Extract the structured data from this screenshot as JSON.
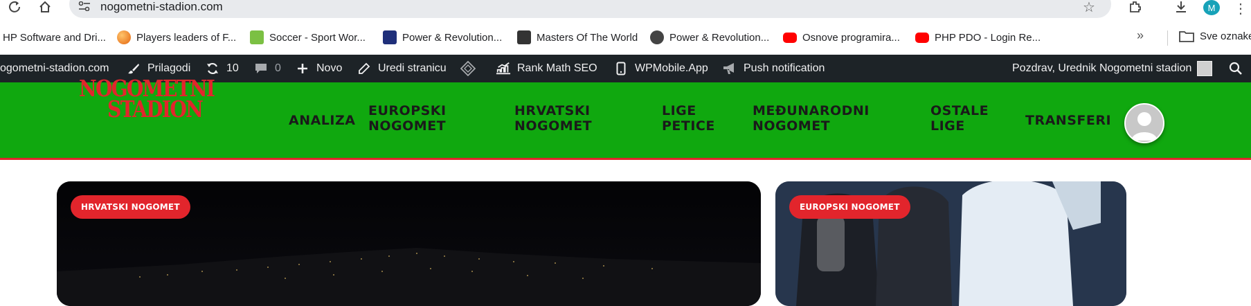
{
  "browser": {
    "url": "nogometni-stadion.com",
    "profile_initial": "M",
    "bookmarks": [
      {
        "label": "HP Software and Dri...",
        "favicon_color": "#1e73be"
      },
      {
        "label": "Players leaders of F...",
        "favicon_color": "#f08a24"
      },
      {
        "label": "Soccer - Sport Wor...",
        "favicon_color": "#7bc043"
      },
      {
        "label": "Power & Revolution...",
        "favicon_color": "#1f2f7a"
      },
      {
        "label": "Masters Of The World",
        "favicon_color": "#333333"
      },
      {
        "label": "Power & Revolution...",
        "favicon_color": "#444444"
      },
      {
        "label": "Osnove programira...",
        "favicon_color": "#ff0000"
      },
      {
        "label": "PHP PDO - Login Re...",
        "favicon_color": "#ff0000"
      }
    ],
    "bookmarks_folder": "Sve oznake"
  },
  "adminbar": {
    "site_name": "ogometni-stadion.com",
    "customize": "Prilagodi",
    "updates_count": "10",
    "comments_count": "0",
    "new": "Novo",
    "edit_page": "Uredi stranicu",
    "rank_math": "Rank Math SEO",
    "wpmobile": "WPMobile.App",
    "push": "Push notification",
    "greeting": "Pozdrav, Urednik Nogometni stadion"
  },
  "site": {
    "logo_line1": "NOGOMETNI",
    "logo_line2": "STADION",
    "accent_color": "#e2252c",
    "header_color": "#10a80f",
    "nav": [
      {
        "line1": "ANALIZA",
        "line2": ""
      },
      {
        "line1": "EUROPSKI",
        "line2": "NOGOMET"
      },
      {
        "line1": "HRVATSKI",
        "line2": "NOGOMET"
      },
      {
        "line1": "LIGE",
        "line2": "PETICE"
      },
      {
        "line1": "MEĐUNARODNI",
        "line2": "NOGOMET"
      },
      {
        "line1": "OSTALE",
        "line2": "LIGE"
      },
      {
        "line1": "TRANSFERI",
        "line2": ""
      }
    ]
  },
  "cards": [
    {
      "badge": "HRVATSKI NOGOMET"
    },
    {
      "badge": "EUROPSKI NOGOMET"
    }
  ]
}
